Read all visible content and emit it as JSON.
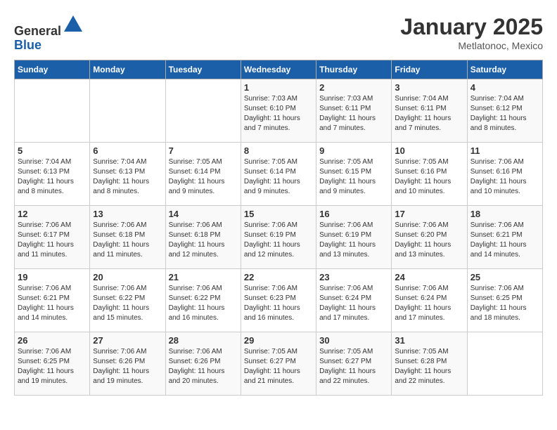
{
  "header": {
    "logo_line1": "General",
    "logo_line2": "Blue",
    "title": "January 2025",
    "subtitle": "Metlatonoc, Mexico"
  },
  "days_of_week": [
    "Sunday",
    "Monday",
    "Tuesday",
    "Wednesday",
    "Thursday",
    "Friday",
    "Saturday"
  ],
  "weeks": [
    [
      {
        "day": "",
        "info": ""
      },
      {
        "day": "",
        "info": ""
      },
      {
        "day": "",
        "info": ""
      },
      {
        "day": "1",
        "info": "Sunrise: 7:03 AM\nSunset: 6:10 PM\nDaylight: 11 hours\nand 7 minutes."
      },
      {
        "day": "2",
        "info": "Sunrise: 7:03 AM\nSunset: 6:11 PM\nDaylight: 11 hours\nand 7 minutes."
      },
      {
        "day": "3",
        "info": "Sunrise: 7:04 AM\nSunset: 6:11 PM\nDaylight: 11 hours\nand 7 minutes."
      },
      {
        "day": "4",
        "info": "Sunrise: 7:04 AM\nSunset: 6:12 PM\nDaylight: 11 hours\nand 8 minutes."
      }
    ],
    [
      {
        "day": "5",
        "info": "Sunrise: 7:04 AM\nSunset: 6:13 PM\nDaylight: 11 hours\nand 8 minutes."
      },
      {
        "day": "6",
        "info": "Sunrise: 7:04 AM\nSunset: 6:13 PM\nDaylight: 11 hours\nand 8 minutes."
      },
      {
        "day": "7",
        "info": "Sunrise: 7:05 AM\nSunset: 6:14 PM\nDaylight: 11 hours\nand 9 minutes."
      },
      {
        "day": "8",
        "info": "Sunrise: 7:05 AM\nSunset: 6:14 PM\nDaylight: 11 hours\nand 9 minutes."
      },
      {
        "day": "9",
        "info": "Sunrise: 7:05 AM\nSunset: 6:15 PM\nDaylight: 11 hours\nand 9 minutes."
      },
      {
        "day": "10",
        "info": "Sunrise: 7:05 AM\nSunset: 6:16 PM\nDaylight: 11 hours\nand 10 minutes."
      },
      {
        "day": "11",
        "info": "Sunrise: 7:06 AM\nSunset: 6:16 PM\nDaylight: 11 hours\nand 10 minutes."
      }
    ],
    [
      {
        "day": "12",
        "info": "Sunrise: 7:06 AM\nSunset: 6:17 PM\nDaylight: 11 hours\nand 11 minutes."
      },
      {
        "day": "13",
        "info": "Sunrise: 7:06 AM\nSunset: 6:18 PM\nDaylight: 11 hours\nand 11 minutes."
      },
      {
        "day": "14",
        "info": "Sunrise: 7:06 AM\nSunset: 6:18 PM\nDaylight: 11 hours\nand 12 minutes."
      },
      {
        "day": "15",
        "info": "Sunrise: 7:06 AM\nSunset: 6:19 PM\nDaylight: 11 hours\nand 12 minutes."
      },
      {
        "day": "16",
        "info": "Sunrise: 7:06 AM\nSunset: 6:19 PM\nDaylight: 11 hours\nand 13 minutes."
      },
      {
        "day": "17",
        "info": "Sunrise: 7:06 AM\nSunset: 6:20 PM\nDaylight: 11 hours\nand 13 minutes."
      },
      {
        "day": "18",
        "info": "Sunrise: 7:06 AM\nSunset: 6:21 PM\nDaylight: 11 hours\nand 14 minutes."
      }
    ],
    [
      {
        "day": "19",
        "info": "Sunrise: 7:06 AM\nSunset: 6:21 PM\nDaylight: 11 hours\nand 14 minutes."
      },
      {
        "day": "20",
        "info": "Sunrise: 7:06 AM\nSunset: 6:22 PM\nDaylight: 11 hours\nand 15 minutes."
      },
      {
        "day": "21",
        "info": "Sunrise: 7:06 AM\nSunset: 6:22 PM\nDaylight: 11 hours\nand 16 minutes."
      },
      {
        "day": "22",
        "info": "Sunrise: 7:06 AM\nSunset: 6:23 PM\nDaylight: 11 hours\nand 16 minutes."
      },
      {
        "day": "23",
        "info": "Sunrise: 7:06 AM\nSunset: 6:24 PM\nDaylight: 11 hours\nand 17 minutes."
      },
      {
        "day": "24",
        "info": "Sunrise: 7:06 AM\nSunset: 6:24 PM\nDaylight: 11 hours\nand 17 minutes."
      },
      {
        "day": "25",
        "info": "Sunrise: 7:06 AM\nSunset: 6:25 PM\nDaylight: 11 hours\nand 18 minutes."
      }
    ],
    [
      {
        "day": "26",
        "info": "Sunrise: 7:06 AM\nSunset: 6:25 PM\nDaylight: 11 hours\nand 19 minutes."
      },
      {
        "day": "27",
        "info": "Sunrise: 7:06 AM\nSunset: 6:26 PM\nDaylight: 11 hours\nand 19 minutes."
      },
      {
        "day": "28",
        "info": "Sunrise: 7:06 AM\nSunset: 6:26 PM\nDaylight: 11 hours\nand 20 minutes."
      },
      {
        "day": "29",
        "info": "Sunrise: 7:05 AM\nSunset: 6:27 PM\nDaylight: 11 hours\nand 21 minutes."
      },
      {
        "day": "30",
        "info": "Sunrise: 7:05 AM\nSunset: 6:27 PM\nDaylight: 11 hours\nand 22 minutes."
      },
      {
        "day": "31",
        "info": "Sunrise: 7:05 AM\nSunset: 6:28 PM\nDaylight: 11 hours\nand 22 minutes."
      },
      {
        "day": "",
        "info": ""
      }
    ]
  ]
}
